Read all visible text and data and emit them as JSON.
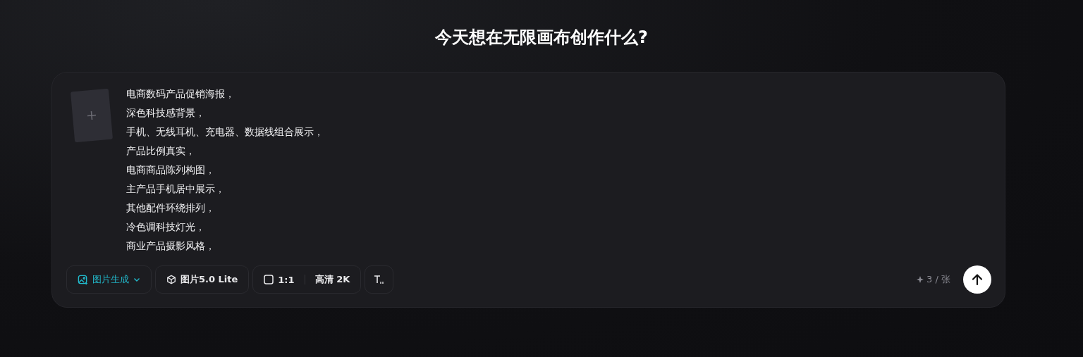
{
  "heading": "今天想在无限画布创作什么?",
  "composer": {
    "reference_image": {
      "kind": "empty"
    },
    "prompt_lines": [
      "电商数码产品促销海报，",
      "深色科技感背景，",
      "手机、无线耳机、充电器、数据线组合展示，",
      "产品比例真实，",
      "电商商品陈列构图，",
      "主产品手机居中展示，",
      "其他配件环绕排列，",
      "冷色调科技灯光，",
      "商业产品摄影风格，"
    ],
    "toolbar": [
      {
        "kind": "mode",
        "label": "图片生成"
      },
      {
        "kind": "model",
        "label": "图片5.0 Lite"
      },
      {
        "kind": "size",
        "ratio": "1:1",
        "quality": "高清 2K"
      },
      {
        "kind": "text"
      }
    ],
    "cost": "3 / 张"
  }
}
